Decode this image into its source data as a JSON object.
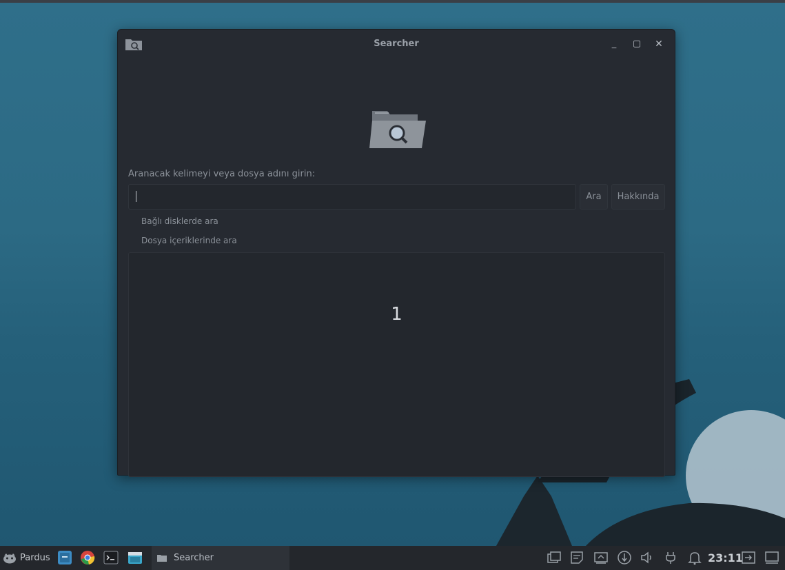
{
  "window": {
    "title": "Searcher",
    "minimize_label": "_",
    "maximize_label": "▢",
    "close_label": "✕"
  },
  "form": {
    "prompt": "Aranacak kelimeyi veya dosya adını girin:",
    "search_value": "",
    "search_button": "Ara",
    "about_button": "Hakkında",
    "option_mounted_disks": "Bağlı disklerde ara",
    "option_file_contents": "Dosya içeriklerinde ara"
  },
  "results": {
    "count_text": "1"
  },
  "taskbar": {
    "menu_label": "Pardus",
    "task_title": "Searcher",
    "clock": "23:11",
    "launchers": [
      "file-manager-icon",
      "chrome-icon",
      "terminal-icon",
      "store-icon"
    ],
    "tray": [
      "workspaces-icon",
      "notes-icon",
      "screenshot-icon",
      "network-icon",
      "volume-icon",
      "power-plug-icon",
      "bell-icon",
      "logout-icon",
      "show-desktop-icon"
    ]
  },
  "colors": {
    "desktop": "#2c6a84",
    "window_bg": "#262a31",
    "taskbar": "#24272c"
  }
}
